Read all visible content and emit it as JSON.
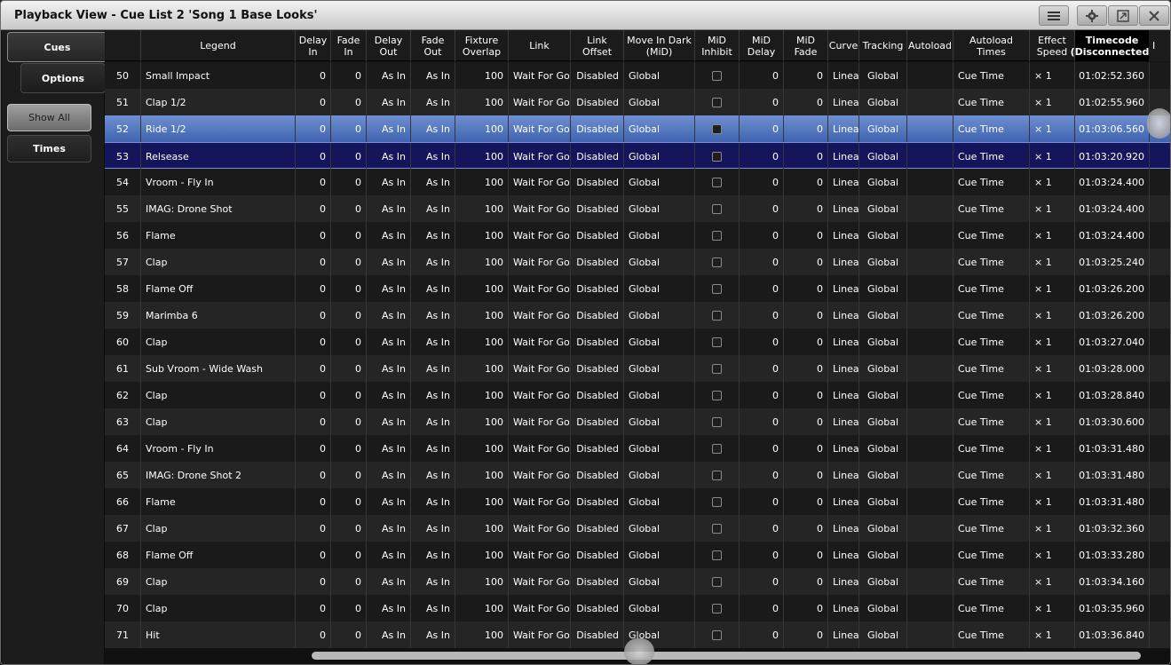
{
  "window": {
    "title": "Playback View - Cue List 2 'Song 1 Base Looks'",
    "buttons": [
      "menu-icon",
      "gear-icon",
      "popout-icon",
      "close-icon"
    ]
  },
  "sidebar": {
    "tab_cues": "Cues",
    "tab_options": "Options",
    "show_all": "Show All",
    "times": "Times"
  },
  "columns": [
    {
      "key": "num",
      "label": ""
    },
    {
      "key": "legend",
      "label": "Legend"
    },
    {
      "key": "delay_in",
      "label": "Delay\nIn"
    },
    {
      "key": "fade_in",
      "label": "Fade\nIn"
    },
    {
      "key": "delay_out",
      "label": "Delay\nOut"
    },
    {
      "key": "fade_out",
      "label": "Fade\nOut"
    },
    {
      "key": "fixture_overlap",
      "label": "Fixture\nOverlap"
    },
    {
      "key": "link",
      "label": "Link"
    },
    {
      "key": "link_offset",
      "label": "Link\nOffset"
    },
    {
      "key": "mid",
      "label": "Move In Dark\n(MiD)"
    },
    {
      "key": "mid_inhibit",
      "label": "MiD\nInhibit"
    },
    {
      "key": "mid_delay",
      "label": "MiD\nDelay"
    },
    {
      "key": "mid_fade",
      "label": "MiD\nFade"
    },
    {
      "key": "curve",
      "label": "Curve"
    },
    {
      "key": "tracking",
      "label": "Tracking"
    },
    {
      "key": "autoload",
      "label": "Autoload"
    },
    {
      "key": "autoload_times",
      "label": "Autoload Times"
    },
    {
      "key": "effect_speed",
      "label": "Effect\nSpeed"
    },
    {
      "key": "timecode",
      "label": "Timecode\n(Disconnected)"
    }
  ],
  "extra_column_label": "I",
  "rows": [
    {
      "num": "50",
      "legend": "Small Impact",
      "delay_in": "0",
      "fade_in": "0",
      "delay_out": "As In",
      "fade_out": "As In",
      "fixture_overlap": "100",
      "link": "Wait For Go",
      "link_offset": "Disabled",
      "mid": "Global",
      "mid_delay": "0",
      "mid_fade": "0",
      "curve": "Linear",
      "tracking": "Global",
      "autoload": "",
      "autoload_times": "Cue Time",
      "effect_speed": "× 1",
      "timecode": "01:02:52.360"
    },
    {
      "num": "51",
      "legend": "Clap 1/2",
      "delay_in": "0",
      "fade_in": "0",
      "delay_out": "As In",
      "fade_out": "As In",
      "fixture_overlap": "100",
      "link": "Wait For Go",
      "link_offset": "Disabled",
      "mid": "Global",
      "mid_delay": "0",
      "mid_fade": "0",
      "curve": "Linear",
      "tracking": "Global",
      "autoload": "",
      "autoload_times": "Cue Time",
      "effect_speed": "× 1",
      "timecode": "01:02:55.960"
    },
    {
      "num": "52",
      "legend": "Ride 1/2",
      "delay_in": "0",
      "fade_in": "0",
      "delay_out": "As In",
      "fade_out": "As In",
      "fixture_overlap": "100",
      "link": "Wait For Go",
      "link_offset": "Disabled",
      "mid": "Global",
      "mid_delay": "0",
      "mid_fade": "0",
      "curve": "Linear",
      "tracking": "Global",
      "autoload": "",
      "autoload_times": "Cue Time",
      "effect_speed": "× 1",
      "timecode": "01:03:06.560",
      "state": "sel-bright"
    },
    {
      "num": "53",
      "legend": "Relsease",
      "delay_in": "0",
      "fade_in": "0",
      "delay_out": "As In",
      "fade_out": "As In",
      "fixture_overlap": "100",
      "link": "Wait For Go",
      "link_offset": "Disabled",
      "mid": "Global",
      "mid_delay": "0",
      "mid_fade": "0",
      "curve": "Linear",
      "tracking": "Global",
      "autoload": "",
      "autoload_times": "Cue Time",
      "effect_speed": "× 1",
      "timecode": "01:03:20.920",
      "state": "sel-dark"
    },
    {
      "num": "54",
      "legend": "Vroom - Fly In",
      "delay_in": "0",
      "fade_in": "0",
      "delay_out": "As In",
      "fade_out": "As In",
      "fixture_overlap": "100",
      "link": "Wait For Go",
      "link_offset": "Disabled",
      "mid": "Global",
      "mid_delay": "0",
      "mid_fade": "0",
      "curve": "Linear",
      "tracking": "Global",
      "autoload": "",
      "autoload_times": "Cue Time",
      "effect_speed": "× 1",
      "timecode": "01:03:24.400"
    },
    {
      "num": "55",
      "legend": "IMAG: Drone Shot",
      "delay_in": "0",
      "fade_in": "0",
      "delay_out": "As In",
      "fade_out": "As In",
      "fixture_overlap": "100",
      "link": "Wait For Go",
      "link_offset": "Disabled",
      "mid": "Global",
      "mid_delay": "0",
      "mid_fade": "0",
      "curve": "Linear",
      "tracking": "Global",
      "autoload": "",
      "autoload_times": "Cue Time",
      "effect_speed": "× 1",
      "timecode": "01:03:24.400"
    },
    {
      "num": "56",
      "legend": "Flame",
      "delay_in": "0",
      "fade_in": "0",
      "delay_out": "As In",
      "fade_out": "As In",
      "fixture_overlap": "100",
      "link": "Wait For Go",
      "link_offset": "Disabled",
      "mid": "Global",
      "mid_delay": "0",
      "mid_fade": "0",
      "curve": "Linear",
      "tracking": "Global",
      "autoload": "",
      "autoload_times": "Cue Time",
      "effect_speed": "× 1",
      "timecode": "01:03:24.400"
    },
    {
      "num": "57",
      "legend": "Clap",
      "delay_in": "0",
      "fade_in": "0",
      "delay_out": "As In",
      "fade_out": "As In",
      "fixture_overlap": "100",
      "link": "Wait For Go",
      "link_offset": "Disabled",
      "mid": "Global",
      "mid_delay": "0",
      "mid_fade": "0",
      "curve": "Linear",
      "tracking": "Global",
      "autoload": "",
      "autoload_times": "Cue Time",
      "effect_speed": "× 1",
      "timecode": "01:03:25.240"
    },
    {
      "num": "58",
      "legend": "Flame Off",
      "delay_in": "0",
      "fade_in": "0",
      "delay_out": "As In",
      "fade_out": "As In",
      "fixture_overlap": "100",
      "link": "Wait For Go",
      "link_offset": "Disabled",
      "mid": "Global",
      "mid_delay": "0",
      "mid_fade": "0",
      "curve": "Linear",
      "tracking": "Global",
      "autoload": "",
      "autoload_times": "Cue Time",
      "effect_speed": "× 1",
      "timecode": "01:03:26.200"
    },
    {
      "num": "59",
      "legend": "Marimba 6",
      "delay_in": "0",
      "fade_in": "0",
      "delay_out": "As In",
      "fade_out": "As In",
      "fixture_overlap": "100",
      "link": "Wait For Go",
      "link_offset": "Disabled",
      "mid": "Global",
      "mid_delay": "0",
      "mid_fade": "0",
      "curve": "Linear",
      "tracking": "Global",
      "autoload": "",
      "autoload_times": "Cue Time",
      "effect_speed": "× 1",
      "timecode": "01:03:26.200"
    },
    {
      "num": "60",
      "legend": "Clap",
      "delay_in": "0",
      "fade_in": "0",
      "delay_out": "As In",
      "fade_out": "As In",
      "fixture_overlap": "100",
      "link": "Wait For Go",
      "link_offset": "Disabled",
      "mid": "Global",
      "mid_delay": "0",
      "mid_fade": "0",
      "curve": "Linear",
      "tracking": "Global",
      "autoload": "",
      "autoload_times": "Cue Time",
      "effect_speed": "× 1",
      "timecode": "01:03:27.040"
    },
    {
      "num": "61",
      "legend": "Sub Vroom - Wide Wash",
      "delay_in": "0",
      "fade_in": "0",
      "delay_out": "As In",
      "fade_out": "As In",
      "fixture_overlap": "100",
      "link": "Wait For Go",
      "link_offset": "Disabled",
      "mid": "Global",
      "mid_delay": "0",
      "mid_fade": "0",
      "curve": "Linear",
      "tracking": "Global",
      "autoload": "",
      "autoload_times": "Cue Time",
      "effect_speed": "× 1",
      "timecode": "01:03:28.000"
    },
    {
      "num": "62",
      "legend": "Clap",
      "delay_in": "0",
      "fade_in": "0",
      "delay_out": "As In",
      "fade_out": "As In",
      "fixture_overlap": "100",
      "link": "Wait For Go",
      "link_offset": "Disabled",
      "mid": "Global",
      "mid_delay": "0",
      "mid_fade": "0",
      "curve": "Linear",
      "tracking": "Global",
      "autoload": "",
      "autoload_times": "Cue Time",
      "effect_speed": "× 1",
      "timecode": "01:03:28.840"
    },
    {
      "num": "63",
      "legend": "Clap",
      "delay_in": "0",
      "fade_in": "0",
      "delay_out": "As In",
      "fade_out": "As In",
      "fixture_overlap": "100",
      "link": "Wait For Go",
      "link_offset": "Disabled",
      "mid": "Global",
      "mid_delay": "0",
      "mid_fade": "0",
      "curve": "Linear",
      "tracking": "Global",
      "autoload": "",
      "autoload_times": "Cue Time",
      "effect_speed": "× 1",
      "timecode": "01:03:30.600"
    },
    {
      "num": "64",
      "legend": "Vroom - Fly In",
      "delay_in": "0",
      "fade_in": "0",
      "delay_out": "As In",
      "fade_out": "As In",
      "fixture_overlap": "100",
      "link": "Wait For Go",
      "link_offset": "Disabled",
      "mid": "Global",
      "mid_delay": "0",
      "mid_fade": "0",
      "curve": "Linear",
      "tracking": "Global",
      "autoload": "",
      "autoload_times": "Cue Time",
      "effect_speed": "× 1",
      "timecode": "01:03:31.480"
    },
    {
      "num": "65",
      "legend": "IMAG: Drone Shot 2",
      "delay_in": "0",
      "fade_in": "0",
      "delay_out": "As In",
      "fade_out": "As In",
      "fixture_overlap": "100",
      "link": "Wait For Go",
      "link_offset": "Disabled",
      "mid": "Global",
      "mid_delay": "0",
      "mid_fade": "0",
      "curve": "Linear",
      "tracking": "Global",
      "autoload": "",
      "autoload_times": "Cue Time",
      "effect_speed": "× 1",
      "timecode": "01:03:31.480"
    },
    {
      "num": "66",
      "legend": "Flame",
      "delay_in": "0",
      "fade_in": "0",
      "delay_out": "As In",
      "fade_out": "As In",
      "fixture_overlap": "100",
      "link": "Wait For Go",
      "link_offset": "Disabled",
      "mid": "Global",
      "mid_delay": "0",
      "mid_fade": "0",
      "curve": "Linear",
      "tracking": "Global",
      "autoload": "",
      "autoload_times": "Cue Time",
      "effect_speed": "× 1",
      "timecode": "01:03:31.480"
    },
    {
      "num": "67",
      "legend": "Clap",
      "delay_in": "0",
      "fade_in": "0",
      "delay_out": "As In",
      "fade_out": "As In",
      "fixture_overlap": "100",
      "link": "Wait For Go",
      "link_offset": "Disabled",
      "mid": "Global",
      "mid_delay": "0",
      "mid_fade": "0",
      "curve": "Linear",
      "tracking": "Global",
      "autoload": "",
      "autoload_times": "Cue Time",
      "effect_speed": "× 1",
      "timecode": "01:03:32.360"
    },
    {
      "num": "68",
      "legend": "Flame Off",
      "delay_in": "0",
      "fade_in": "0",
      "delay_out": "As In",
      "fade_out": "As In",
      "fixture_overlap": "100",
      "link": "Wait For Go",
      "link_offset": "Disabled",
      "mid": "Global",
      "mid_delay": "0",
      "mid_fade": "0",
      "curve": "Linear",
      "tracking": "Global",
      "autoload": "",
      "autoload_times": "Cue Time",
      "effect_speed": "× 1",
      "timecode": "01:03:33.280"
    },
    {
      "num": "69",
      "legend": "Clap",
      "delay_in": "0",
      "fade_in": "0",
      "delay_out": "As In",
      "fade_out": "As In",
      "fixture_overlap": "100",
      "link": "Wait For Go",
      "link_offset": "Disabled",
      "mid": "Global",
      "mid_delay": "0",
      "mid_fade": "0",
      "curve": "Linear",
      "tracking": "Global",
      "autoload": "",
      "autoload_times": "Cue Time",
      "effect_speed": "× 1",
      "timecode": "01:03:34.160"
    },
    {
      "num": "70",
      "legend": "Clap",
      "delay_in": "0",
      "fade_in": "0",
      "delay_out": "As In",
      "fade_out": "As In",
      "fixture_overlap": "100",
      "link": "Wait For Go",
      "link_offset": "Disabled",
      "mid": "Global",
      "mid_delay": "0",
      "mid_fade": "0",
      "curve": "Linear",
      "tracking": "Global",
      "autoload": "",
      "autoload_times": "Cue Time",
      "effect_speed": "× 1",
      "timecode": "01:03:35.960"
    },
    {
      "num": "71",
      "legend": "Hit",
      "delay_in": "0",
      "fade_in": "0",
      "delay_out": "As In",
      "fade_out": "As In",
      "fixture_overlap": "100",
      "link": "Wait For Go",
      "link_offset": "Disabled",
      "mid": "Global",
      "mid_delay": "0",
      "mid_fade": "0",
      "curve": "Linear",
      "tracking": "Global",
      "autoload": "",
      "autoload_times": "Cue Time",
      "effect_speed": "× 1",
      "timecode": "01:03:36.840"
    }
  ],
  "colors": {
    "selected_bright": "#5a7cc4",
    "selected_dark": "#14155a",
    "row_odd": "#1a1a1a",
    "row_even": "#252525"
  }
}
